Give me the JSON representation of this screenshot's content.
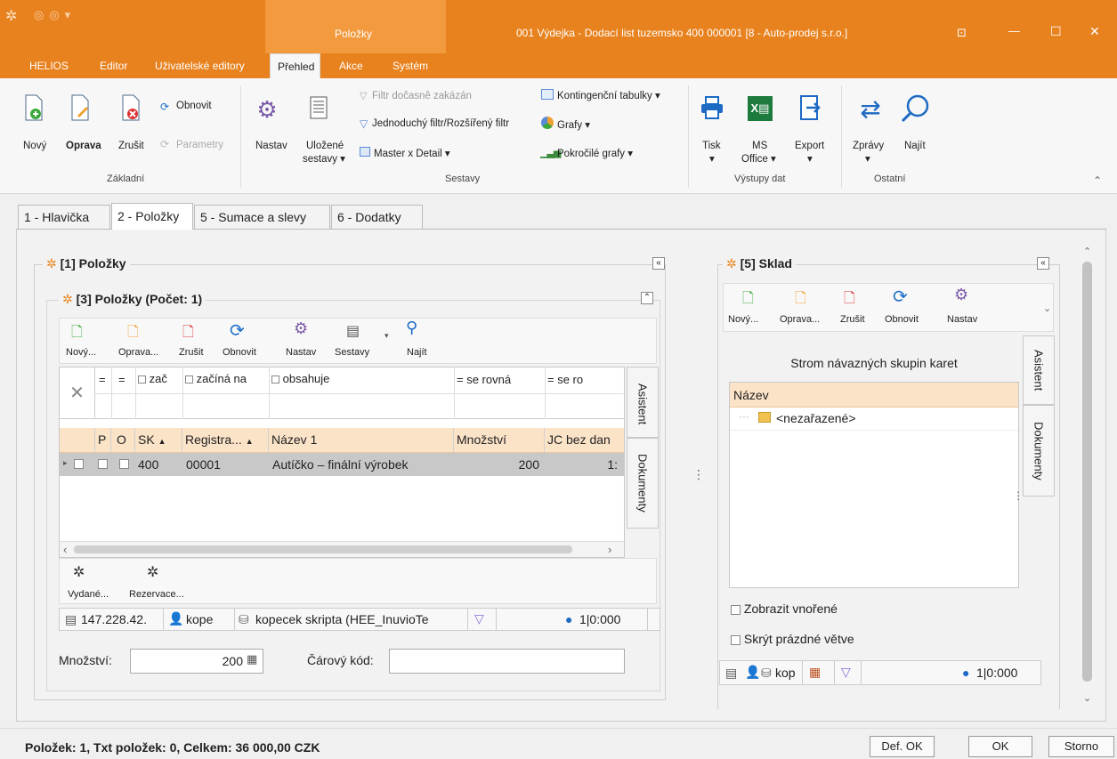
{
  "window": {
    "title": "001  Výdejka - Dodací list tuzemsko  400 000001 [8 - Auto-prodej s.r.o.]",
    "context_tab": "Položky",
    "controls": {
      "pin": "⊡",
      "minimize": "—",
      "maximize": "☐",
      "close": "✕"
    }
  },
  "ribbon": {
    "tabs": [
      "HELIOS",
      "Editor",
      "Uživatelské editory",
      "Přehled",
      "Akce",
      "Systém"
    ],
    "active_tab": "Přehled",
    "zakladni": {
      "novy": "Nový",
      "oprava": "Oprava",
      "zrusit": "Zrušit",
      "obnovit": "Obnovit",
      "parametry": "Parametry",
      "group": "Základní"
    },
    "sestavy": {
      "nastav": "Nastav",
      "ulozene": "Uložené",
      "ulozene2": "sestavy ▾",
      "filtr_docasne": "Filtr dočasně zakázán",
      "jednoduchy_filtr": "Jednoduchý filtr/Rozšířený filtr",
      "master_detail": "Master x Detail  ▾",
      "kontingencni": "Kontingenční tabulky  ▾",
      "grafy": "Grafy  ▾",
      "pokrocile": "Pokročilé grafy  ▾",
      "group": "Sestavy"
    },
    "vystupy": {
      "tisk": "Tisk",
      "tisk2": "▾",
      "ms": "MS",
      "office": "Office ▾",
      "export": "Export",
      "export2": "▾",
      "group": "Výstupy dat"
    },
    "ostatni": {
      "zpravy": "Zprávy",
      "zpravy2": "▾",
      "najit": "Najít",
      "group": "Ostatní"
    }
  },
  "doc_tabs": [
    "1 - Hlavička",
    "2 - Položky",
    "5 - Sumace a slevy",
    "6 - Dodatky"
  ],
  "polozky_panel": {
    "title": "[1] Položky",
    "collapse": "«",
    "sub_title": "[3] Položky (Počet: 1)",
    "sub_collapse": "⌃",
    "toolbar": [
      "Nový...",
      "Oprava...",
      "Zrušit",
      "Obnovit",
      "Nastav",
      "Sestavy",
      "Najít"
    ],
    "filter_ops": [
      "=",
      "=",
      "zač",
      "začíná na",
      "obsahuje",
      "= se rovná",
      "= se ro"
    ],
    "columns": [
      "P",
      "O",
      "SK",
      "Registra...",
      "Název 1",
      "Množství",
      "JC bez dan"
    ],
    "rows": [
      {
        "sk": "400",
        "reg": "00001",
        "nazev": "Autíčko – finální výrobek",
        "mnozstvi": "200",
        "jc": "1:"
      }
    ],
    "side_tabs": [
      "Asistent",
      "Dokumenty"
    ],
    "bottom_btns": [
      "Vydané...",
      "Rezervace..."
    ],
    "status": {
      "ip": "147.228.42.",
      "user": "kope",
      "db": "kopecek skripta (HEE_InuvioTe",
      "info": "1|0:000"
    },
    "mnozstvi_label": "Množství:",
    "mnozstvi_value": "200",
    "carovy_label": "Čárový kód:",
    "carovy_value": ""
  },
  "sklad_panel": {
    "title": "[5] Sklad",
    "collapse": "«",
    "toolbar": [
      "Nový...",
      "Oprava...",
      "Zrušit",
      "Obnovit",
      "Nastav"
    ],
    "tree_title": "Strom návazných skupin karet",
    "col_header": "Název",
    "tree_item": "<nezařazené>",
    "side_tabs": [
      "Asistent",
      "Dokumenty"
    ],
    "opt1": "Zobrazit vnořené",
    "opt2": "Skrýt prázdné větve",
    "status": {
      "db": "kop",
      "info": "1|0:000"
    }
  },
  "footer": {
    "summary": "Položek: 1,  Txt položek: 0,  Celkem: 36 000,00 CZK",
    "def_ok": "Def. OK",
    "ok": "OK",
    "storno": "Storno"
  }
}
